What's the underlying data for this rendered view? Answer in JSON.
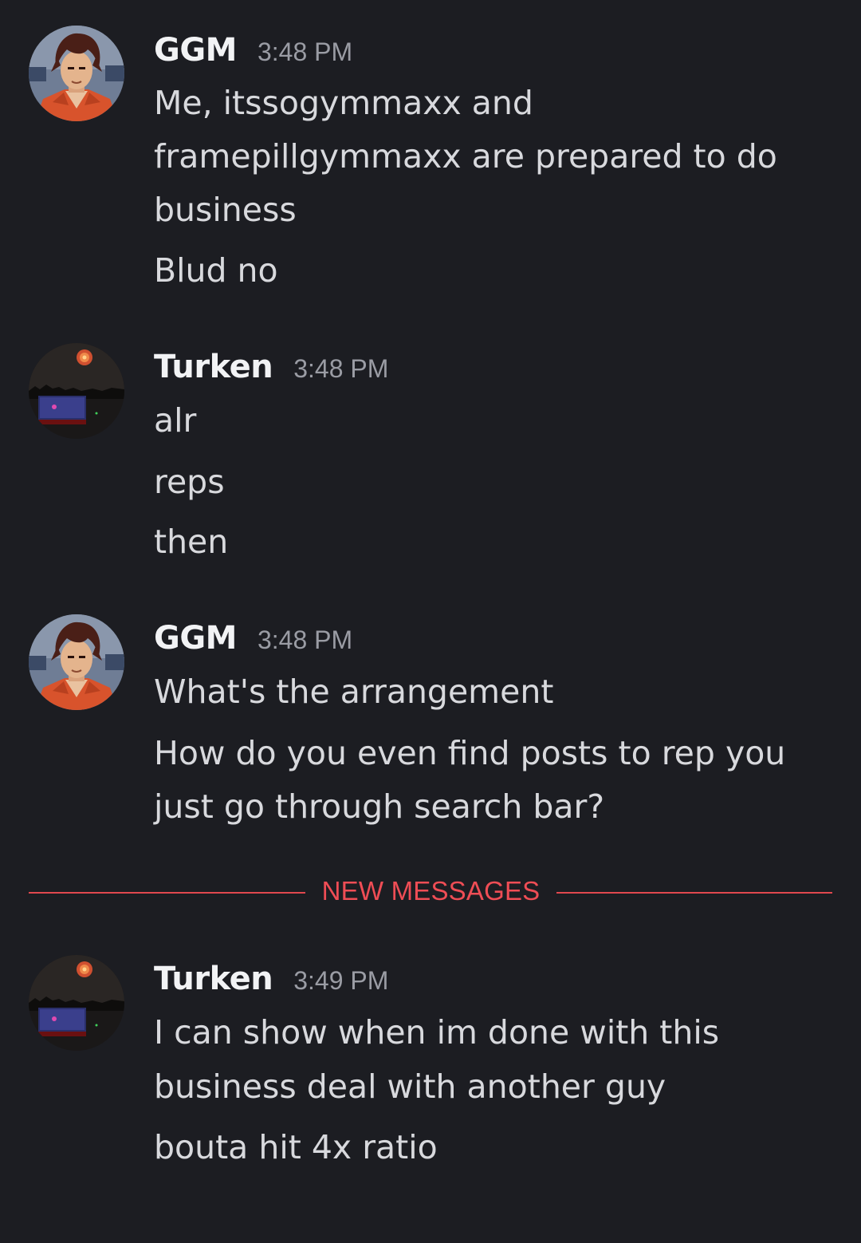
{
  "colors": {
    "background": "#1c1d22",
    "username": "#f2f3f5",
    "timestamp": "#9a9ca4",
    "message_text": "#d8d9dd",
    "new_messages_accent": "#ef4d55"
  },
  "messages": [
    {
      "author": "GGM",
      "time": "3:48 PM",
      "avatar": "anime-character-avatar",
      "lines": [
        "Me, itssogymmaxx and",
        "framepillgymmaxx are prepared to do",
        "business",
        "Blud no"
      ]
    },
    {
      "author": "Turken",
      "time": "3:48 PM",
      "avatar": "night-sky-fireworks-avatar",
      "lines": [
        "alr",
        "reps",
        "then"
      ]
    },
    {
      "author": "GGM",
      "time": "3:48 PM",
      "avatar": "anime-character-avatar",
      "lines": [
        "What's the arrangement",
        "How do you even find posts to rep you",
        "just go through search bar?"
      ]
    },
    {
      "author": "Turken",
      "time": "3:49 PM",
      "avatar": "night-sky-fireworks-avatar",
      "lines": [
        "I can show when im done with this",
        "business deal with another guy",
        "bouta hit 4x ratio"
      ]
    }
  ],
  "new_messages_divider": {
    "label": "NEW MESSAGES"
  }
}
